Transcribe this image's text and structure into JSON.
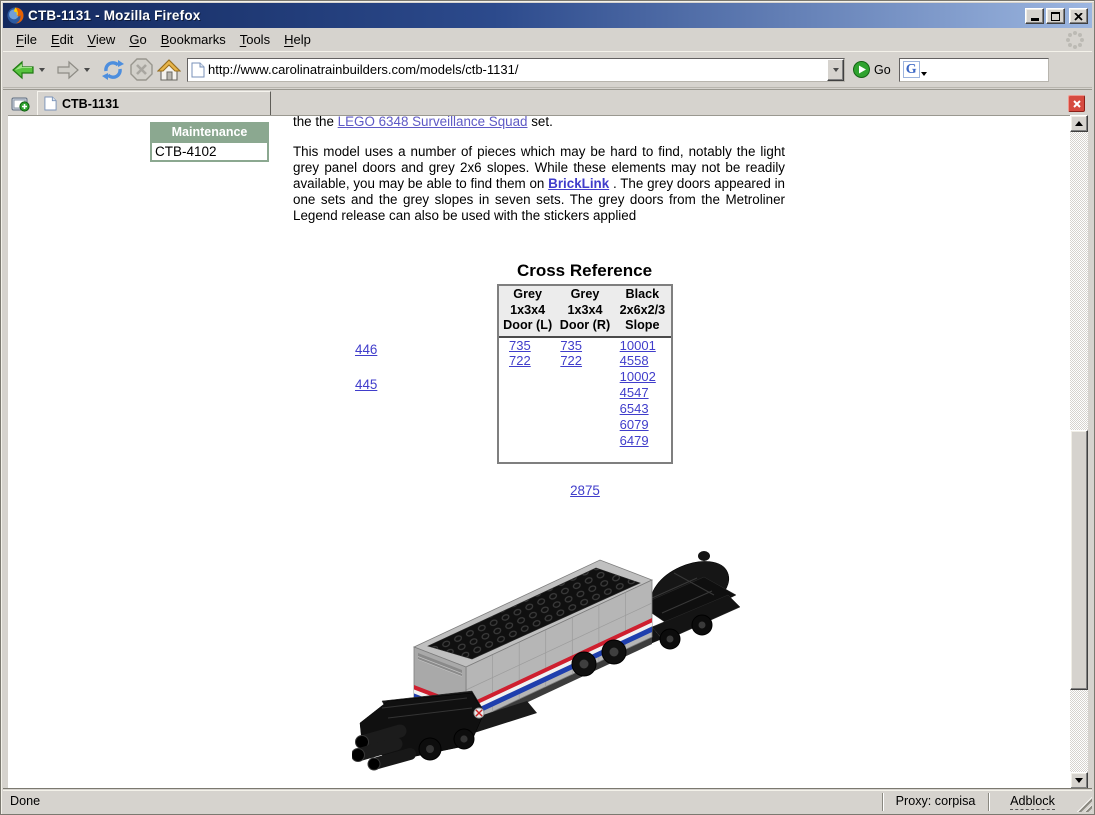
{
  "window": {
    "title": "CTB-1131 - Mozilla Firefox"
  },
  "menu": {
    "items": [
      "File",
      "Edit",
      "View",
      "Go",
      "Bookmarks",
      "Tools",
      "Help"
    ]
  },
  "toolbar": {
    "url": "http://www.carolinatrainbuilders.com/models/ctb-1131/",
    "go_label": "Go",
    "search_value": ""
  },
  "tabs": {
    "active": "CTB-1131"
  },
  "sidebar": {
    "header": "Maintenance",
    "item": "CTB-4102"
  },
  "content": {
    "intro_segments": [
      {
        "t": "the the "
      },
      {
        "a": "LEGO 6348 Surveillance Squad",
        "visited": true
      },
      {
        "t": " set."
      }
    ],
    "para_segments": [
      {
        "t": "This model uses a number of pieces which may be hard to find, notably the light grey panel doors and grey 2x6 slopes. While these elements may not be readily available, you may be able to find them on "
      },
      {
        "a": "BrickLink",
        "bold": true
      },
      {
        "t": " . The grey doors appeared in one sets and the grey slopes in seven sets. The grey doors from the Metroliner Legend release can also be used with the stickers applied"
      }
    ],
    "cross_reference": {
      "title": "Cross Reference",
      "columns": [
        {
          "header": [
            "Grey",
            "1x3x4",
            "Door (L)"
          ],
          "links": [
            "735",
            "722"
          ]
        },
        {
          "header": [
            "Grey",
            "1x3x4",
            "Door (R)"
          ],
          "links": [
            "735",
            "722"
          ]
        },
        {
          "header": [
            "Black",
            "2x6x2/3",
            "Slope"
          ],
          "links": [
            "10001",
            "4558",
            "10002",
            "4547",
            "6543",
            "6079",
            "6479"
          ]
        }
      ]
    },
    "left_links": [
      "446",
      "445"
    ],
    "bottom_link": "2875"
  },
  "statusbar": {
    "status": "Done",
    "proxy": "Proxy: corpisa",
    "adblock": "Adblock"
  },
  "icons": [
    "firefox-icon",
    "back-icon",
    "forward-icon",
    "reload-icon",
    "stop-icon",
    "home-icon",
    "page-icon",
    "go-icon",
    "google-icon",
    "new-tab-icon",
    "tab-close-icon",
    "throbber-icon"
  ],
  "colors": {
    "titlebar_start": "#13295e",
    "titlebar_end": "#9cb6e0",
    "chrome_grey": "#d6d3ce",
    "maintenance_green": "#8ba890",
    "link_blue": "#403dcb",
    "visited_link": "#5e59c5",
    "tab_close_red": "#d64b40"
  }
}
